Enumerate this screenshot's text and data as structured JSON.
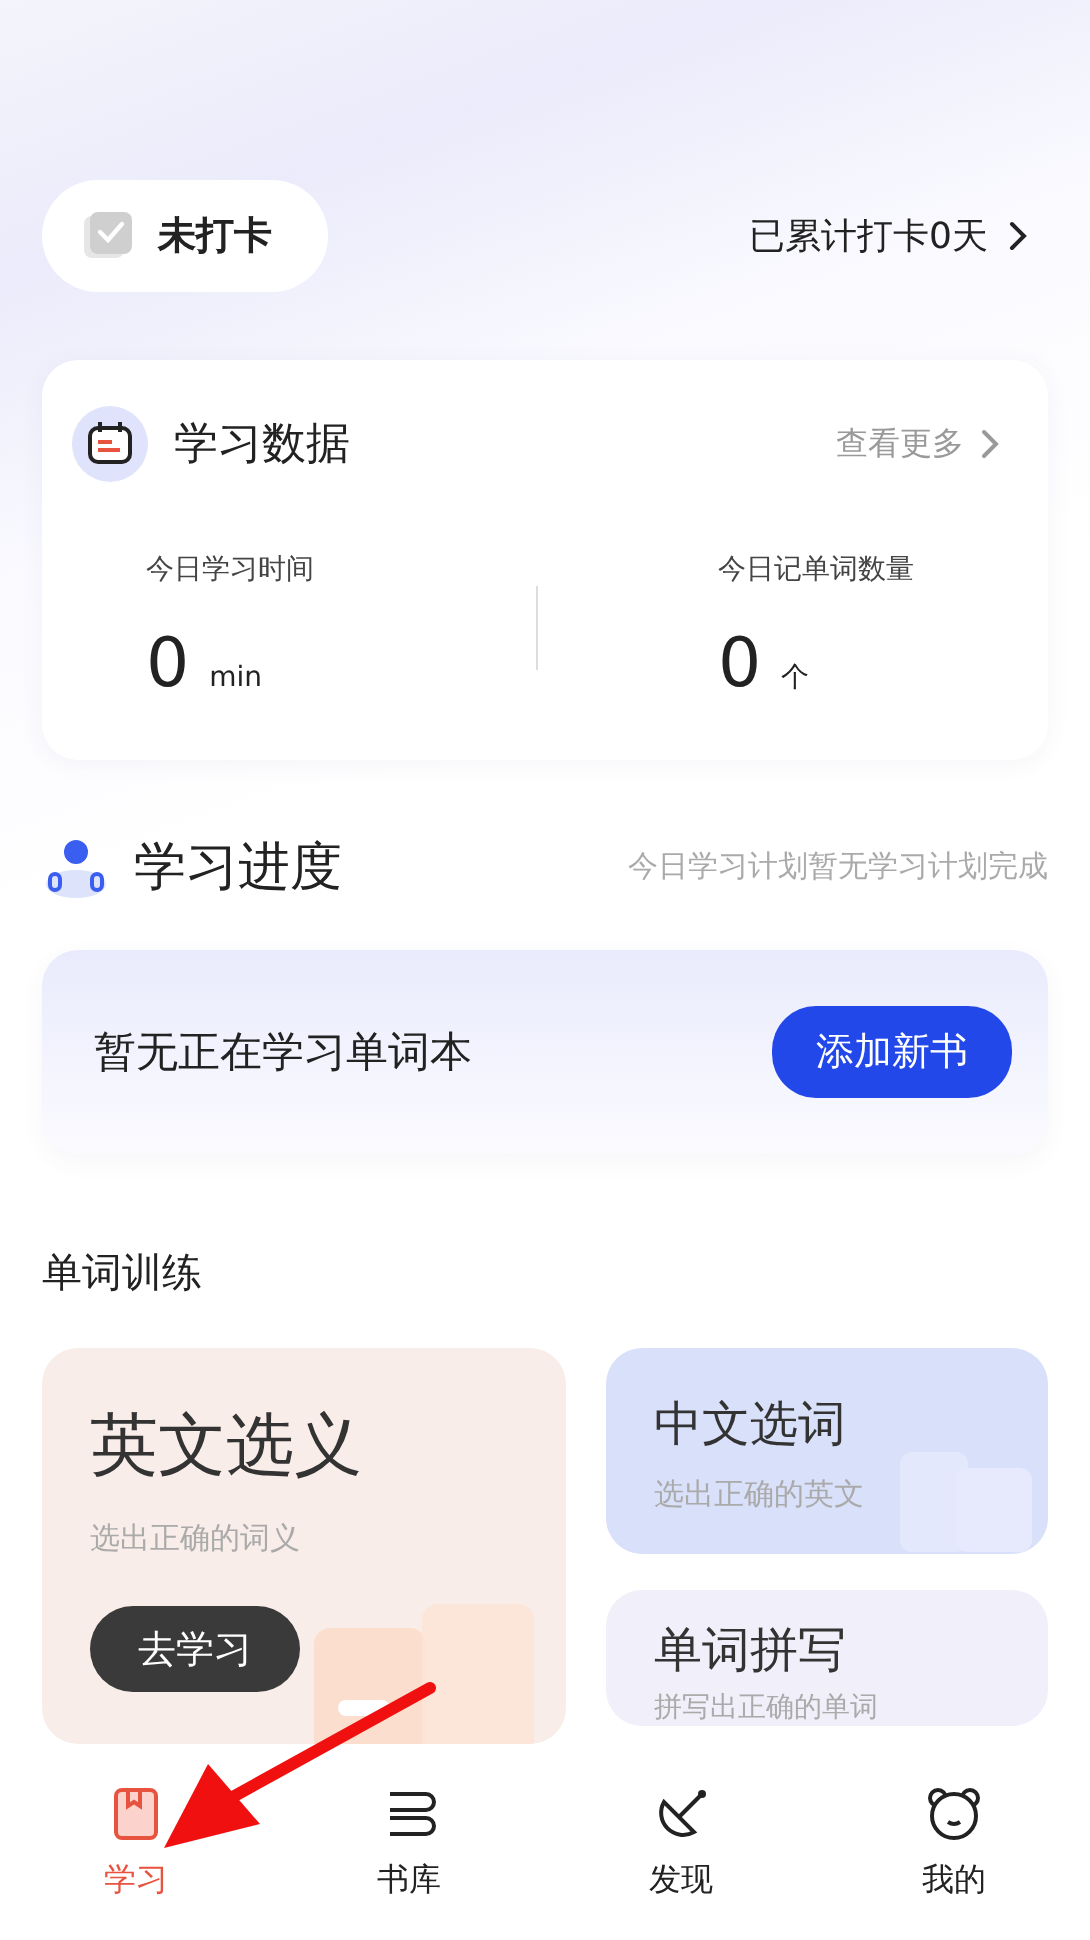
{
  "checkin": {
    "label": "未打卡",
    "checked": false,
    "total": "已累计打卡0天"
  },
  "study_data": {
    "title": "学习数据",
    "more": "查看更多",
    "stats": [
      {
        "label": "今日学习时间",
        "value": "0",
        "unit": "min"
      },
      {
        "label": "今日记单词数量",
        "value": "0",
        "unit": "个"
      }
    ]
  },
  "progress": {
    "title": "学习进度",
    "note": "今日学习计划暂无学习计划完成",
    "empty": "暂无正在学习单词本",
    "button": "添加新书"
  },
  "training": {
    "title": "单词训练",
    "cards": [
      {
        "kind": "big",
        "title": "英文选义",
        "subtitle": "选出正确的词义",
        "button": "去学习"
      },
      {
        "kind": "translate",
        "title": "中文选词",
        "subtitle": "选出正确的英文"
      },
      {
        "kind": "spell",
        "title": "单词拼写",
        "subtitle": "拼写出正确的单词"
      }
    ]
  },
  "tabs": [
    {
      "label": "学习",
      "selected": true
    },
    {
      "label": "书库",
      "selected": false
    },
    {
      "label": "发现",
      "selected": false
    },
    {
      "label": "我的",
      "selected": false
    }
  ]
}
